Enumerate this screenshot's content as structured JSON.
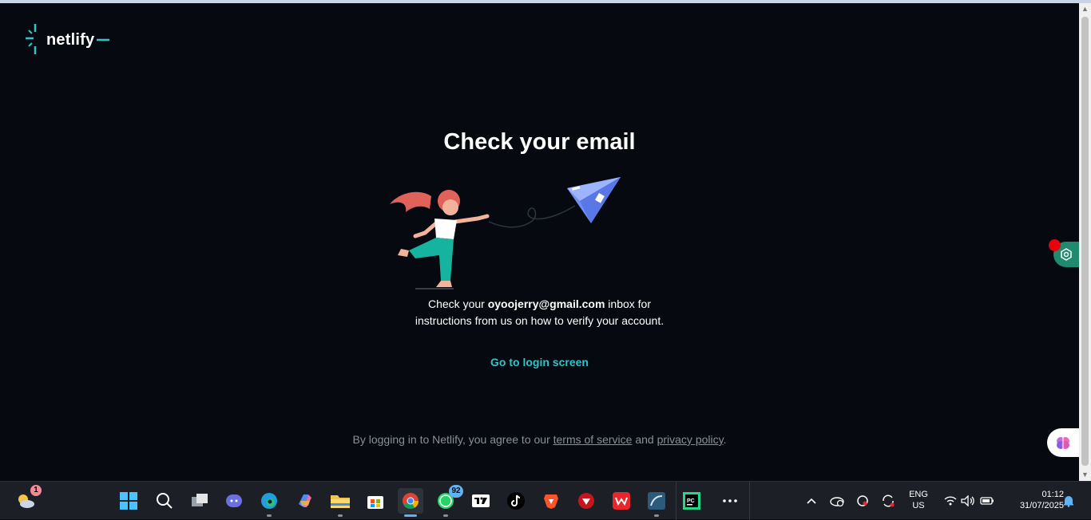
{
  "brand": {
    "name": "netlify",
    "accent": "#32c3c9"
  },
  "main": {
    "title": "Check your email",
    "message_prefix": "Check your ",
    "email": "oyoojerry@gmail.com",
    "message_mid": " inbox for",
    "message_line2": "instructions from us on how to verify your account.",
    "login_link": "Go to login screen"
  },
  "legal": {
    "prefix": "By logging in to Netlify, you agree to our ",
    "terms": "terms of service",
    "and": " and ",
    "privacy": "privacy policy",
    "suffix": "."
  },
  "taskbar": {
    "weather_badge": "1",
    "whatsapp_badge": "92",
    "apps": [
      "weather-icon",
      "start-icon",
      "search-icon",
      "task-view-icon",
      "teams-icon",
      "edge-icon",
      "copilot-icon",
      "file-explorer-icon",
      "store-icon",
      "chrome-icon",
      "whatsapp-icon",
      "tradingview-icon",
      "tiktok-icon",
      "brave-icon",
      "antivirus-icon",
      "wps-icon",
      "mysql-workbench-icon",
      "pycharm-icon",
      "more-icon"
    ],
    "tray": {
      "language_line1": "ENG",
      "language_line2": "US",
      "time": "01:12",
      "date": "31/07/2025"
    }
  },
  "colors": {
    "page_bg": "#06090f",
    "taskbar_bg": "#1c1f26",
    "link": "#32c3c9",
    "muted": "#8a8f98"
  }
}
